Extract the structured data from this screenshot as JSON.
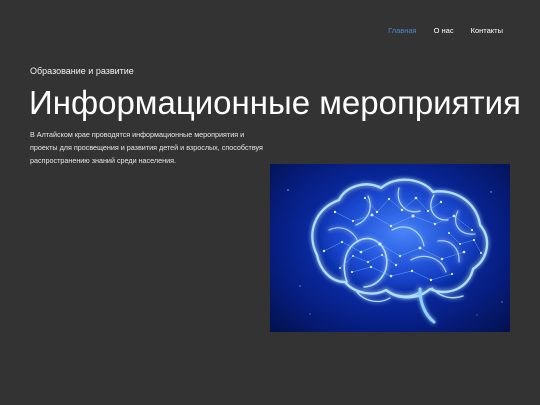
{
  "nav": {
    "items": [
      {
        "label": "Главная",
        "active": true
      },
      {
        "label": "О нас",
        "active": false
      },
      {
        "label": "Контакты",
        "active": false
      }
    ],
    "active_color": "#4d86c8"
  },
  "hero": {
    "eyebrow": "Образование и развитие",
    "title": "Информационные мероприятия",
    "description": "В Алтайском крае проводятся информационные мероприятия и проекты для просвещения и развития детей и взрослых, способствуя распространению знаний среди населения.",
    "image_icon": "glowing-brain-illustration"
  },
  "colors": {
    "background": "#333333",
    "text": "#ffffff",
    "brain_glow": "#9fd7ff",
    "image_background": "#0b2ca7"
  }
}
